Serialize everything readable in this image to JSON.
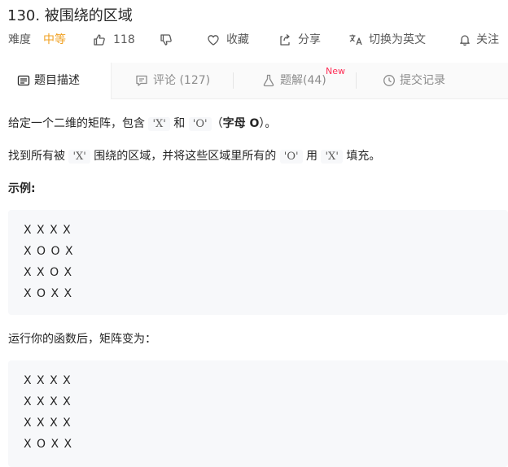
{
  "problem": {
    "title": "130. 被围绕的区域",
    "difficulty_label": "难度",
    "difficulty": "中等",
    "likes": "118",
    "actions": {
      "favorite": "收藏",
      "share": "分享",
      "switch_lang": "切换为英文",
      "follow": "关注"
    }
  },
  "tabs": [
    {
      "label": "题目描述"
    },
    {
      "label": "评论 (127)"
    },
    {
      "label": "题解(44)",
      "badge": "New"
    },
    {
      "label": "提交记录"
    }
  ],
  "description": {
    "line1": {
      "pre": "给定一个二维的矩阵，包含 ",
      "code1": "'X'",
      "mid": " 和 ",
      "code2": "'O'",
      "paren_open": "（",
      "bold": "字母 O",
      "paren_close": "）。"
    },
    "line2": {
      "pre": "找到所有被 ",
      "code1": "'X'",
      "mid1": " 围绕的区域，并将这些区域里所有的 ",
      "code2": "'O'",
      "mid2": " 用 ",
      "code3": "'X'",
      "post": " 填充。"
    },
    "example_heading": "示例:",
    "input_rows": [
      "X X X X",
      "X O O X",
      "X X O X",
      "X O X X"
    ],
    "after_text": "运行你的函数后，矩阵变为：",
    "output_rows": [
      "X X X X",
      "X X X X",
      "X X X X",
      "X O X X"
    ]
  }
}
